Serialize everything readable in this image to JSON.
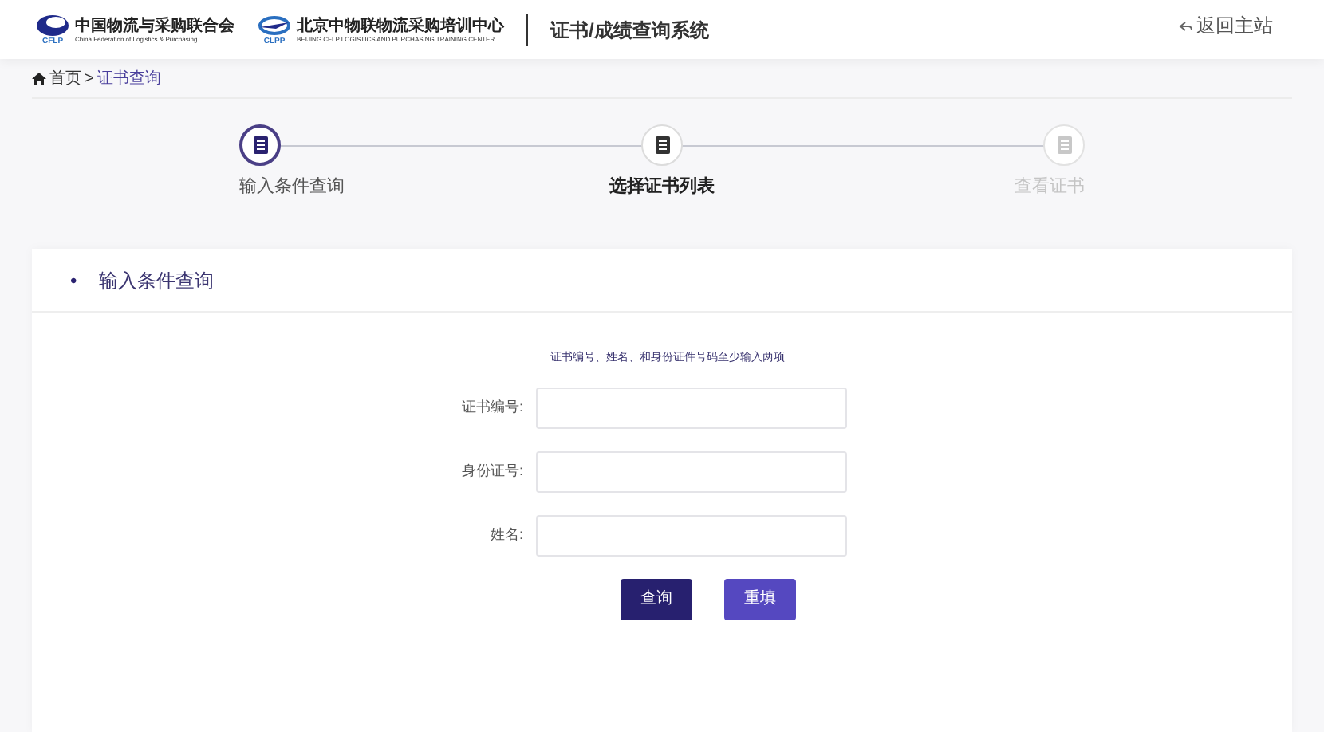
{
  "header": {
    "logos": [
      {
        "name": "中国物流与采购联合会",
        "subtitle": "China Federation of Logistics & Purchasing",
        "mark": "CFLP"
      },
      {
        "name": "北京中物联物流采购培训中心",
        "subtitle": "BEIJING CFLP LOGISTICS AND PURCHASING TRAINING CENTER",
        "mark": "CLPP"
      }
    ],
    "system_title": "证书/成绩查询系统",
    "back_link": "返回主站"
  },
  "breadcrumb": {
    "home": "首页",
    "separator": ">",
    "current": "证书查询"
  },
  "steps": [
    {
      "label": "输入条件查询",
      "completed": true,
      "selected": false
    },
    {
      "label": "选择证书列表",
      "completed": false,
      "selected": true
    },
    {
      "label": "查看证书",
      "completed": false,
      "selected": false
    }
  ],
  "panel": {
    "bullet": "•",
    "title": "输入条件查询",
    "hint": "证书编号、姓名、和身份证件号码至少输入两项",
    "fields": [
      {
        "label": "证书编号:"
      },
      {
        "label": "身份证号:"
      },
      {
        "label": "姓名:"
      }
    ],
    "buttons": [
      {
        "label": "查询",
        "kind": "primary"
      },
      {
        "label": "重填",
        "kind": "secondary"
      }
    ]
  }
}
